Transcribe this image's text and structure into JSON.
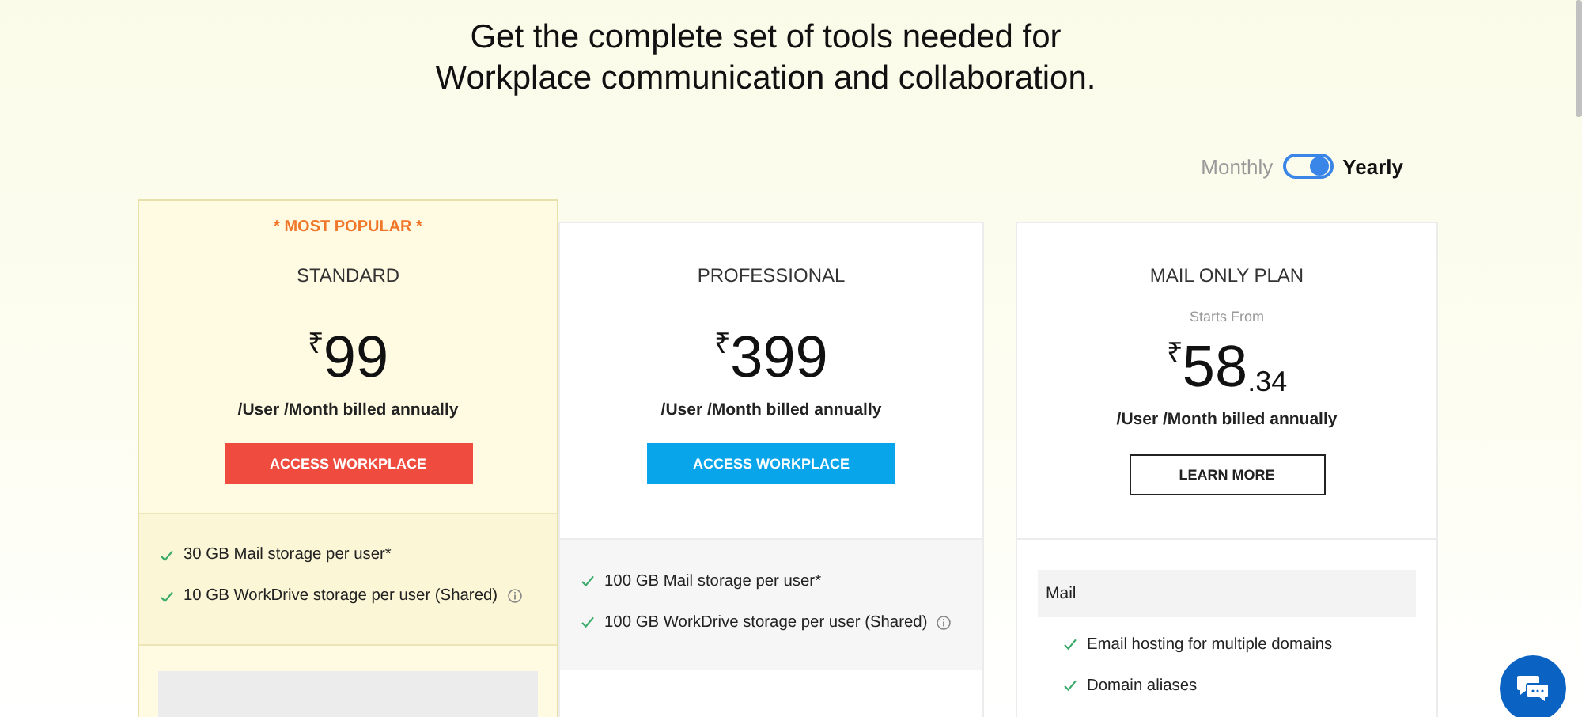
{
  "heading": [
    "Get the complete set of tools needed for",
    "Workplace communication and collaboration."
  ],
  "billing_toggle": {
    "left_label": "Monthly",
    "right_label": "Yearly",
    "on": true
  },
  "plans": [
    {
      "badge": "* MOST POPULAR *",
      "name": "STANDARD",
      "highlighted": true,
      "currency": "₹",
      "price": "99",
      "period": "/User /Month billed annually",
      "button": {
        "label": "ACCESS WORKPLACE",
        "kind": "filled",
        "color": "#ef4b3f"
      },
      "features": [
        {
          "text": "30 GB Mail storage per user*",
          "info": false
        },
        {
          "text": "10 GB WorkDrive storage per user (Shared)",
          "info": true
        }
      ]
    },
    {
      "name": "PROFESSIONAL",
      "highlighted": false,
      "currency": "₹",
      "price": "399",
      "period": "/User /Month billed annually",
      "button": {
        "label": "ACCESS WORKPLACE",
        "kind": "filled",
        "color": "#08a5eb"
      },
      "features": [
        {
          "text": "100 GB Mail storage per user*",
          "info": false
        },
        {
          "text": "100 GB WorkDrive storage per user (Shared)",
          "info": true
        }
      ]
    },
    {
      "name": "MAIL ONLY PLAN",
      "highlighted": false,
      "starts_from": "Starts From",
      "currency": "₹",
      "price": "58",
      "price_decimals": ".34",
      "period": "/User /Month billed annually",
      "button": {
        "label": "LEARN MORE",
        "kind": "outline",
        "color": "#222222"
      },
      "feature_group": "Mail",
      "features": [
        {
          "text": "Email hosting for multiple domains",
          "info": false
        },
        {
          "text": "Domain aliases",
          "info": false
        }
      ]
    }
  ]
}
